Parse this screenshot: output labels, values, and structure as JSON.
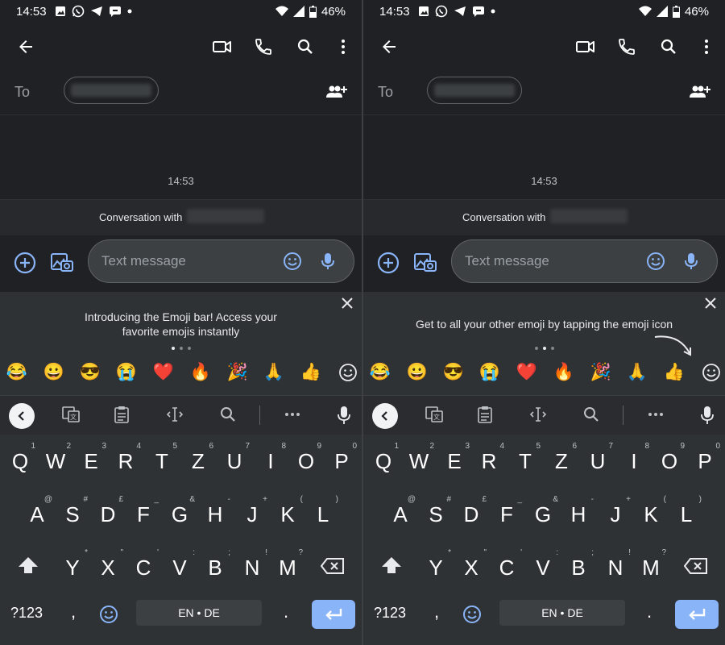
{
  "status": {
    "time": "14:53",
    "battery": "46%"
  },
  "to_label": "To",
  "conversation": {
    "timestamp": "14:53",
    "with_label": "Conversation with"
  },
  "compose": {
    "placeholder": "Text message"
  },
  "banner": {
    "left_message": "Introducing the Emoji bar! Access your favorite emojis instantly",
    "right_message": "Get to all your other emoji by tapping the emoji icon",
    "left_page_index": 0,
    "right_page_index": 1,
    "page_count": 3
  },
  "emoji_bar": [
    "😂",
    "😀",
    "😎",
    "😭",
    "❤️",
    "🔥",
    "🎉",
    "🙏",
    "👍"
  ],
  "keyboard": {
    "row1": [
      {
        "k": "Q",
        "h": "1"
      },
      {
        "k": "W",
        "h": "2"
      },
      {
        "k": "E",
        "h": "3"
      },
      {
        "k": "R",
        "h": "4"
      },
      {
        "k": "T",
        "h": "5"
      },
      {
        "k": "Z",
        "h": "6"
      },
      {
        "k": "U",
        "h": "7"
      },
      {
        "k": "I",
        "h": "8"
      },
      {
        "k": "O",
        "h": "9"
      },
      {
        "k": "P",
        "h": "0"
      }
    ],
    "row2": [
      {
        "k": "A",
        "h": "@"
      },
      {
        "k": "S",
        "h": "#"
      },
      {
        "k": "D",
        "h": "£"
      },
      {
        "k": "F",
        "h": "_"
      },
      {
        "k": "G",
        "h": "&"
      },
      {
        "k": "H",
        "h": "-"
      },
      {
        "k": "J",
        "h": "+"
      },
      {
        "k": "K",
        "h": "("
      },
      {
        "k": "L",
        "h": ")"
      }
    ],
    "row3": [
      {
        "k": "Y",
        "h": "*"
      },
      {
        "k": "X",
        "h": "\""
      },
      {
        "k": "C",
        "h": "'"
      },
      {
        "k": "V",
        "h": ":"
      },
      {
        "k": "B",
        "h": ";"
      },
      {
        "k": "N",
        "h": "!"
      },
      {
        "k": "M",
        "h": "?"
      }
    ],
    "numbers_label": "?123",
    "comma": ",",
    "period": ".",
    "space_label": "EN • DE"
  },
  "colors": {
    "accent": "#8ab4f8",
    "background": "#202124",
    "keyboard": "#2f3235"
  }
}
